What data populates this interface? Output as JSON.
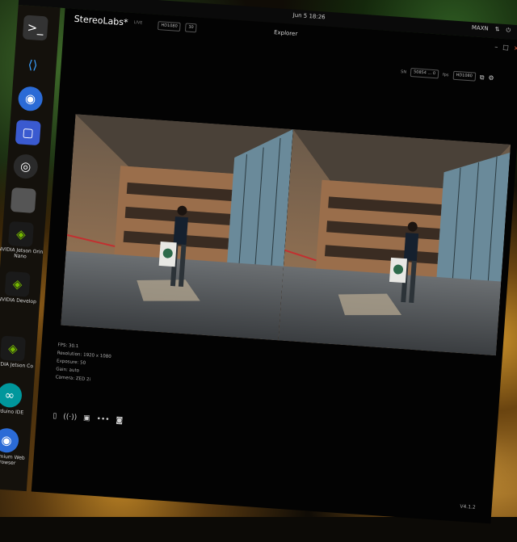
{
  "topbar": {
    "clock": "Jun 5 18:26",
    "tray": [
      "MAXN"
    ]
  },
  "dock": {
    "items": [
      {
        "name": "terminal",
        "label": ""
      },
      {
        "name": "vscode",
        "label": ""
      },
      {
        "name": "chromium",
        "label": ""
      },
      {
        "name": "obs",
        "label": ""
      },
      {
        "name": "app-window",
        "label": ""
      },
      {
        "name": "nvidia-app",
        "label": "NVIDIA Jetson Orin Nano"
      },
      {
        "name": "nvidia-devel",
        "label": "NVIDIA Develop"
      },
      {
        "name": "nvidia-app2",
        "label": "NVIDIA Jetson Co"
      },
      {
        "name": "arduino",
        "label": "Arduino IDE"
      },
      {
        "name": "chromium-web",
        "label": "Chromium Web Browser"
      }
    ]
  },
  "window": {
    "brand": "StereoLabs*",
    "mode_label": "LIVE",
    "resolution_select": "HD1080",
    "fps_select": "30",
    "title": "Explorer",
    "toolbar": {
      "label_a": "SN",
      "field_a": "50854 ... 0",
      "label_b": "fps",
      "field_b": "HD1080"
    },
    "info_lines": [
      "FPS: 30.1",
      "Resolution: 1920 x 1080",
      "Exposure: 50",
      "Gain: auto",
      "Camera: ZED 2i"
    ],
    "version": "V4.1.2"
  },
  "colors": {
    "accent": "#d33f3f",
    "nvidia": "#76b900"
  }
}
